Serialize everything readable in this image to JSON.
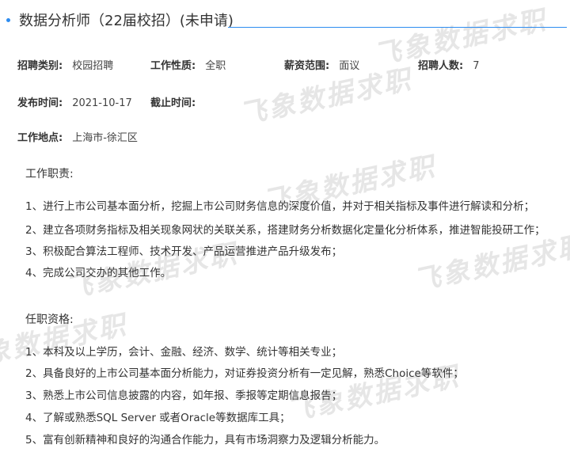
{
  "title": "数据分析师（22届校招）(未申请)",
  "fields": {
    "category_label": "招聘类别:",
    "category_value": "校园招聘",
    "nature_label": "工作性质:",
    "nature_value": "全职",
    "salary_label": "薪资范围:",
    "salary_value": "面议",
    "count_label": "招聘人数:",
    "count_value": "7",
    "publish_label": "发布时间:",
    "publish_value": "2021-10-17",
    "deadline_label": "截止时间:",
    "deadline_value": "",
    "location_label": "工作地点:",
    "location_value": "上海市-徐汇区"
  },
  "duties": {
    "title": "工作职责:",
    "items": [
      "1、进行上市公司基本面分析，挖掘上市公司财务信息的深度价值，并对于相关指标及事件进行解读和分析；",
      "2、建立各项财务指标及相关现象网状的关联关系，搭建财务分析数据化定量化分析体系，推进智能投研工作；",
      "3、积极配合算法工程师、技术开发、产品运营推进产品升级发布；",
      "4、完成公司交办的其他工作。"
    ]
  },
  "requirements": {
    "title": "任职资格:",
    "items": [
      "1、本科及以上学历，会计、金融、经济、数学、统计等相关专业；",
      "2、具备良好的上市公司基本面分析能力，对证券投资分析有一定见解，熟悉Choice等软件；",
      "3、熟悉上市公司信息披露的内容，如年报、季报等定期信息报告；",
      "4、了解或熟悉SQL Server 或者Oracle等数据库工具；",
      "5、富有创新精神和良好的沟通合作能力，具有市场洞察力及逻辑分析能力。"
    ]
  },
  "watermark": "飞象数据求职",
  "colors": {
    "accent": "#2d8cf0",
    "watermark": "#d2d2d2"
  }
}
